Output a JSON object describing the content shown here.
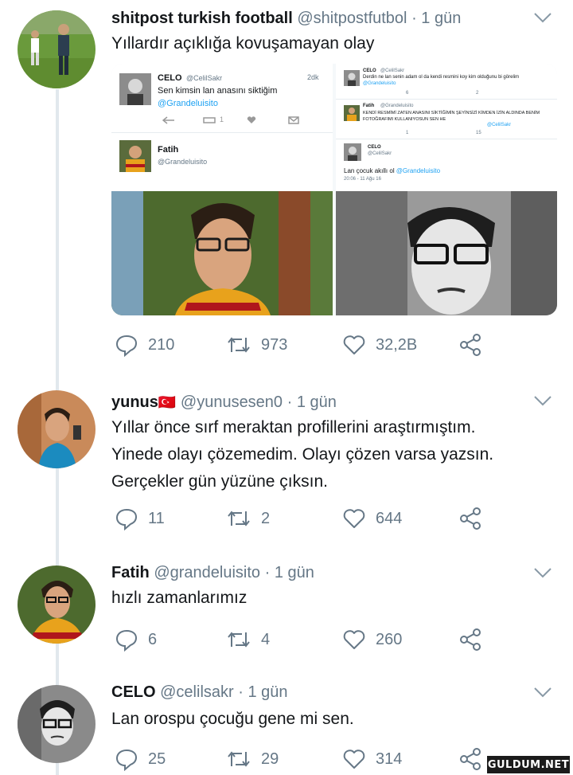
{
  "tweets": [
    {
      "name": "shitpost turkish football",
      "handle": "@shitpostfutbol",
      "dot": "·",
      "time": "1 gün",
      "text": "Yıllardır açıklığa kovuşamayan olay",
      "replies": "210",
      "retweets": "973",
      "likes": "32,2B",
      "avatar_icon": "football-player-photo",
      "embedded": {
        "left_top": {
          "name": "CELO",
          "handle": "@CelilSakr",
          "time": "2dk",
          "text": "Sen kimsin lan anasını siktiğim",
          "mention": "@Grandeluisito",
          "rt_count": "1"
        },
        "left_bottom": {
          "name": "Fatih",
          "handle": "@Grandeluisito"
        },
        "right_top": {
          "name": "CELO",
          "handle": "@CelilSakr",
          "text": "Derdin ne lan senin adam ol da kendi resmini koy kim olduğunu bi görelim",
          "mention": "@Grandeluisito",
          "c1": "6",
          "c2": "2"
        },
        "right_mid": {
          "name": "Fatih",
          "handle": "@Grandeluisito",
          "text": "KENDİ RESMİMİ ZATEN ANASINI SİKTİĞİMİN ŞEYİNSİZİ KİMDEN İZİN ALDINDA BENİM FOTOĞRAFIMI KULLANIYOSUN SEN HE",
          "mention": "@CelilSakr",
          "c1": "1",
          "c2": "15"
        },
        "right_bottom": {
          "name": "CELO",
          "handle": "@CelilSakr",
          "text": "Lan çocuk akıllı ol",
          "mention": "@Grandeluisito",
          "date": "20:06 - 11 Ağu 16"
        }
      }
    },
    {
      "name": "yunus",
      "flag": "🇹🇷",
      "handle": "@yunusesen0",
      "dot": "·",
      "time": "1 gün",
      "text_lines": [
        "Yıllar önce sırf meraktan profillerini araştırmıştım.",
        "Yinede olayı çözemedim. Olayı çözen varsa yazsın.",
        "Gerçekler gün yüzüne çıksın."
      ],
      "replies": "11",
      "retweets": "2",
      "likes": "644"
    },
    {
      "name": "Fatih",
      "handle": "@grandeluisito",
      "dot": "·",
      "time": "1 gün",
      "text": "hızlı zamanlarımız",
      "replies": "6",
      "retweets": "4",
      "likes": "260"
    },
    {
      "name": "CELO",
      "handle": "@celilsakr",
      "dot": "·",
      "time": "1 gün",
      "text": "Lan orospu çocuğu gene mi sen.",
      "replies": "25",
      "retweets": "29",
      "likes": "314"
    }
  ],
  "watermark": "GULDUM.NET",
  "colors": {
    "text": "#14171a",
    "secondary": "#657786",
    "link": "#1da1f2",
    "thread_line": "#e1e8ed"
  }
}
